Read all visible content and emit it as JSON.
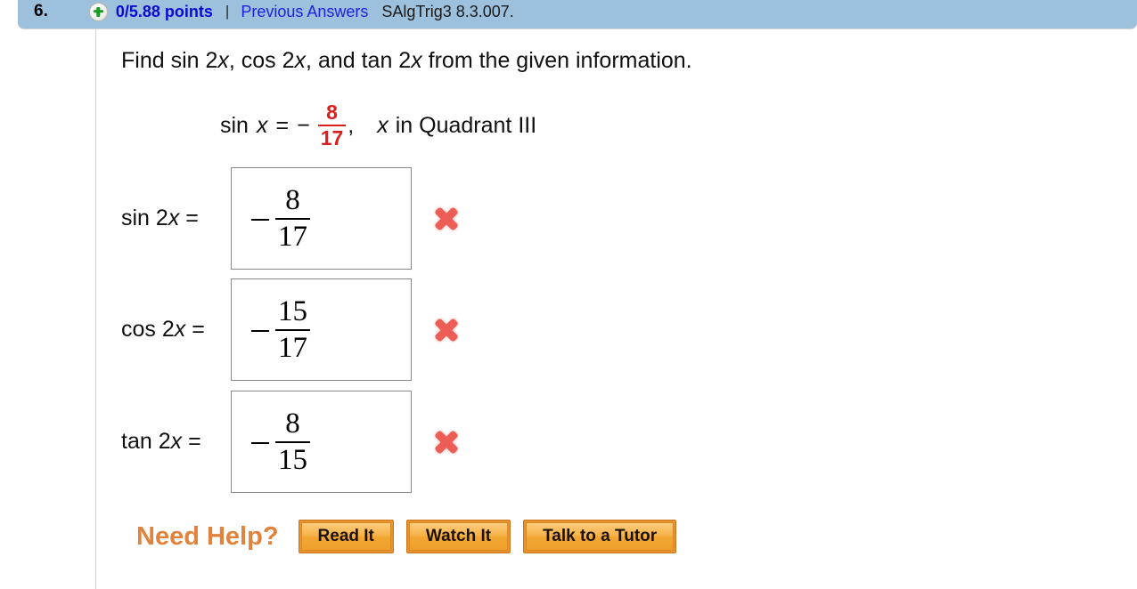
{
  "header": {
    "question_number": "6.",
    "plus_icon": "plus-circle-icon",
    "points": "0/5.88 points",
    "separator": "|",
    "previous_answers_link": "Previous Answers",
    "question_code": "SAlgTrig3 8.3.007.",
    "bar_color": "#9dc0dd",
    "points_color": "#0a0ad2",
    "link_color": "#2020e0"
  },
  "problem": {
    "prompt_part1": "Find sin 2",
    "prompt_x1": "x",
    "prompt_part2": ", cos 2",
    "prompt_x2": "x",
    "prompt_part3": ", and tan 2",
    "prompt_x3": "x",
    "prompt_part4": " from the given information.",
    "given": {
      "lead": "sin",
      "variable": "x",
      "equals": "=",
      "sign": "−",
      "numerator": "8",
      "denominator": "17",
      "comma": ",",
      "condition_variable": "x",
      "condition": "in Quadrant III",
      "fraction_color": "#d81f1f"
    }
  },
  "answers": [
    {
      "label_fn": "sin 2",
      "label_var": "x",
      "label_eq": "=",
      "sign": "−",
      "numerator": "8",
      "denominator": "17",
      "status": "incorrect",
      "status_icon": "x-mark-icon"
    },
    {
      "label_fn": "cos 2",
      "label_var": "x",
      "label_eq": "=",
      "sign": "−",
      "numerator": "15",
      "denominator": "17",
      "status": "incorrect",
      "status_icon": "x-mark-icon"
    },
    {
      "label_fn": "tan 2",
      "label_var": "x",
      "label_eq": "=",
      "sign": "−",
      "numerator": "8",
      "denominator": "15",
      "status": "incorrect",
      "status_icon": "x-mark-icon"
    }
  ],
  "help": {
    "label": "Need Help?",
    "label_color": "#e2833d",
    "buttons": [
      {
        "text": "Read It"
      },
      {
        "text": "Watch It"
      },
      {
        "text": "Talk to a Tutor"
      }
    ]
  }
}
